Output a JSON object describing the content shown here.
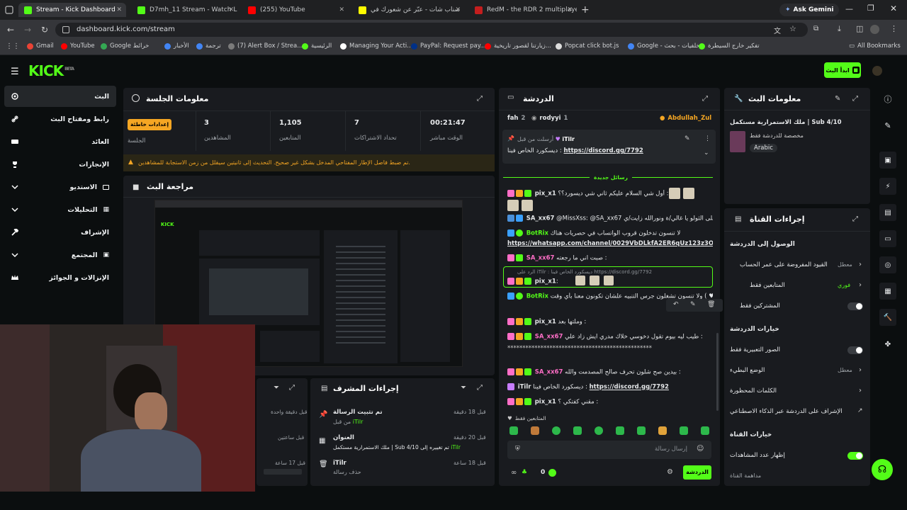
{
  "browser": {
    "tabs": [
      {
        "title": "Stream - Kick Dashboard",
        "color": "#53fc18"
      },
      {
        "title": "D7mh_11 Stream - Watch L",
        "color": "#53fc18"
      },
      {
        "title": "(255) YouTube",
        "color": "#ff0000"
      },
      {
        "title": "سناب شات - عبّر عن شعورك في",
        "color": "#fffc00"
      },
      {
        "title": "RedM - the RDR 2 multiplayer",
        "color": "#c41e1e"
      }
    ],
    "ask_gemini": "Ask Gemini",
    "url": "dashboard.kick.com/stream",
    "bookmarks": [
      "Gmail",
      "YouTube",
      "Google خرائط",
      "الأخبار",
      "ترجمة",
      "(7) Alert Box / Strea...",
      "الرئيسية",
      "Managing Your Acti...",
      "PayPal: Request pay...",
      "زيارتنا لقصور تاريخية...",
      "Popcat click bot.js",
      "Google - خلفيات - بحث",
      "تفكير خارج السيطرة"
    ],
    "all_bookmarks": "All Bookmarks"
  },
  "kick": {
    "logo": "KICK",
    "beta": "BETA",
    "go_live": "ابدأ البث"
  },
  "sidebar": {
    "items": [
      {
        "label": "البث"
      },
      {
        "label": "رابط ومفتاح البث"
      },
      {
        "label": "العائد"
      },
      {
        "label": "الإنجازات"
      },
      {
        "label": "الاستديو"
      },
      {
        "label": "التحليلات"
      },
      {
        "label": "الإشراف"
      },
      {
        "label": "المجتمع"
      },
      {
        "label": "الإنزالات و الجوائز"
      }
    ]
  },
  "session": {
    "title": "معلومات الجلسة",
    "badge": "إعدادات خاطئة",
    "session_label": "الجلسة",
    "stats": [
      {
        "value": "00:21:47",
        "label": "الوقت مباشر"
      },
      {
        "value": "7",
        "label": "تحداد الاشتراكات"
      },
      {
        "value": "1,105",
        "label": "المتابعين"
      },
      {
        "value": "3",
        "label": "المشاهدين"
      }
    ],
    "warning": "تم ضبط فاصل الإطار المفتاحي المدخل بشكل غير صحيح. التحديث إلى ثانيتين سيقلل من زمن الاستجابة للمشاهدين."
  },
  "preview": {
    "title": "مراجعة البث"
  },
  "mod_actions": {
    "title": "إجراءات المشرف",
    "items": [
      {
        "title": "تم تثبيت الرسالة",
        "sub": "من قبل",
        "user": "iTilr",
        "time": "قبل 18 دقيقة"
      },
      {
        "title": "العنوان",
        "sub": "ملك الاستمرارية مستكمل | Sub 4/10 تم تغييره إلى",
        "user": "iTilr",
        "time": "قبل 20 دقيقة"
      },
      {
        "title": "iTilr",
        "sub": "حذف رسالة",
        "user": "",
        "time": "قبل 18 ساعة"
      }
    ],
    "left_times": [
      "قبل دقيقة واحدة",
      "قبل ساعتين",
      "قبل 17 ساعة"
    ]
  },
  "chat": {
    "title": "الدردشة",
    "top_users": [
      {
        "name": "Abdullah_Zul"
      },
      {
        "name": "rodyyi",
        "count": "1"
      },
      {
        "name": "fah",
        "count": "2"
      }
    ],
    "pinned": {
      "author": "iTilr",
      "prefix": "أرسلت من قبل",
      "text": "ديسكورد الخاص فينا :",
      "link": "https://discord.gg/7792"
    },
    "new_messages": "رسائل جديدة",
    "messages": [
      {
        "user": "pix_x1",
        "color": "#e6e8ea",
        "text": "أول شي السلام عليكم ثاني شي ديسورد؟؟ :"
      },
      {
        "user": "SA_xx67",
        "color": "#e6e8ea",
        "text": "@MissXss: @SA_xx67 شكرًا على الثولو يا غالي/ة ونورالله زايت/ي"
      },
      {
        "user": "BotRix",
        "color": "#53fc18",
        "text": "لا تنسون تدخلون قروب الواتساب في حصريات هناك"
      },
      {
        "user": "",
        "color": "#e6e8ea",
        "text": "https://whatsapp.com/channel/0029VbDLkfA2ER6qUz123z3O"
      },
      {
        "user": "SA_xx67",
        "color": "#ff6ec7",
        "text": "صبت اني ما رجعته :"
      },
      {
        "user": "pix_x1",
        "color": "#e6e8ea",
        "text": ":"
      },
      {
        "user": "BotRix",
        "color": "#53fc18",
        "text": "لا تنسون زر الفولو ( ♥ ) ولا تنسون تشغلون جرس التنبيه علشان تكونون معنا بأي وقت"
      },
      {
        "user": "pix_x1",
        "color": "#e6e8ea",
        "text": "وملتها بعد :"
      },
      {
        "user": "SA_xx67",
        "color": "#ff6ec7",
        "text": "طيب ليه بيوم تقول دخوسي خلاك مدري ايش زاد علي :"
      },
      {
        "user": "",
        "color": "#e6e8ea",
        "text": "************************************************"
      },
      {
        "user": "SA_xx67",
        "color": "#ff6ec7",
        "text": "بيدين صح شلون تحرف صالح المصدمت والله :"
      },
      {
        "user": "iTilr",
        "color": "#e6e8ea",
        "text": "ديسكورد الخاص فينا :",
        "link": "https://discord.gg/7792"
      },
      {
        "user": "pix_x1",
        "color": "#e6e8ea",
        "text": "مقني كفتكي ؟ :"
      }
    ],
    "reply_preview": "الرد على iTilr : ديسكورد الخاص فينا https://discord.gg/7792",
    "followers_only": "المتابعين فقط",
    "placeholder": "إرسال رسالة",
    "send": "الدردشة",
    "count": "0"
  },
  "stream_info": {
    "title": "معلومات البث",
    "stream_title": "ملك الاستمرارية مستكمل | Sub 4/10",
    "category": "مخصصة للدردشة فقط",
    "language": "Arabic"
  },
  "channel_actions": {
    "title": "إجراءات القناة",
    "chat_access": "الوصول إلى الدردشة",
    "rows": [
      {
        "label": "القيود المفروضة على عمر الحساب",
        "value": "معطل"
      },
      {
        "label": "المتابعين فقط",
        "value": "فوري"
      },
      {
        "label": "المشتركين فقط",
        "value": ""
      }
    ],
    "chat_options": "خيارات الدردشة",
    "rows2": [
      {
        "label": "الصور التعبيرية فقط",
        "value": ""
      },
      {
        "label": "الوضع البطيء",
        "value": "معطل"
      },
      {
        "label": "الكلمات المحظورة",
        "value": ""
      },
      {
        "label": "الإشراف على الدردشة عبر الذكاء الاصطناعي",
        "value": ""
      }
    ],
    "channel_options": "خيارات القناة",
    "show_views": "إظهار عدد المشاهدات",
    "channel_rules": "مداهمة القناة"
  }
}
